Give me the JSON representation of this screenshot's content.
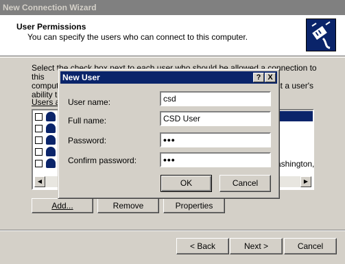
{
  "wizard": {
    "title": "New Connection Wizard",
    "header_title": "User Permissions",
    "header_subtitle": "You can specify the users who can connect to this computer.",
    "instructions_line1": "Select the check box next to each user who should be allowed a connection to this",
    "instructions_line2_left": "compute",
    "instructions_line2_right": "ect a user's",
    "instructions_line3": "ability to",
    "users_label": "Users al",
    "list_partial_text": "ashington,(",
    "add_label": "Add...",
    "remove_label": "Remove",
    "properties_label": "Properties",
    "back_label": "< Back",
    "next_label": "Next >",
    "cancel_label": "Cancel"
  },
  "dialog": {
    "title": "New User",
    "help_label": "?",
    "close_label": "X",
    "fields": {
      "username_label": "User name:",
      "username_value": "csd",
      "fullname_label": "Full name:",
      "fullname_value": "CSD User",
      "password_label": "Password:",
      "password_value": "•••",
      "confirm_label": "Confirm password:",
      "confirm_value": "•••"
    },
    "ok_label": "OK",
    "cancel_label": "Cancel"
  },
  "icons": {
    "wizard_header": "network-plug-icon",
    "user": "user-icon",
    "scroll_left": "arrow-left-icon",
    "scroll_right": "arrow-right-icon"
  },
  "colors": {
    "titlebar_active": "#0a246a",
    "titlebar_inactive": "#808080",
    "face": "#d4d0c8"
  }
}
